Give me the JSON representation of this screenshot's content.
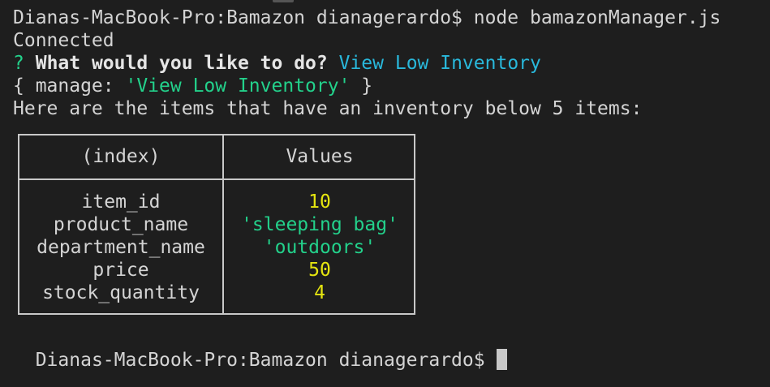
{
  "terminal": {
    "command_line": "Dianas-MacBook-Pro:Bamazon dianagerardo$ node bamazonManager.js",
    "connected": "Connected",
    "prompt_mark": "?",
    "prompt_question": "What would you like to do?",
    "prompt_answer": "View Low Inventory",
    "result_open": "{ manage: ",
    "result_value": "'View Low Inventory'",
    "result_close": " }",
    "info_line": "Here are the items that have an inventory below 5 items:",
    "final_prompt": "Dianas-MacBook-Pro:Bamazon dianagerardo$"
  },
  "table": {
    "headers": [
      "(index)",
      "Values"
    ],
    "rows": [
      {
        "index": "item_id",
        "value": "10",
        "type": "number"
      },
      {
        "index": "product_name",
        "value": "'sleeping bag'",
        "type": "string"
      },
      {
        "index": "department_name",
        "value": "'outdoors'",
        "type": "string"
      },
      {
        "index": "price",
        "value": "50",
        "type": "number"
      },
      {
        "index": "stock_quantity",
        "value": "4",
        "type": "number"
      }
    ]
  },
  "colors": {
    "background": "#1e1e1e",
    "text": "#d4d4d4",
    "string": "#23d18b",
    "number": "#e5e510",
    "answer": "#29b8db",
    "border": "#c8c8c8"
  }
}
